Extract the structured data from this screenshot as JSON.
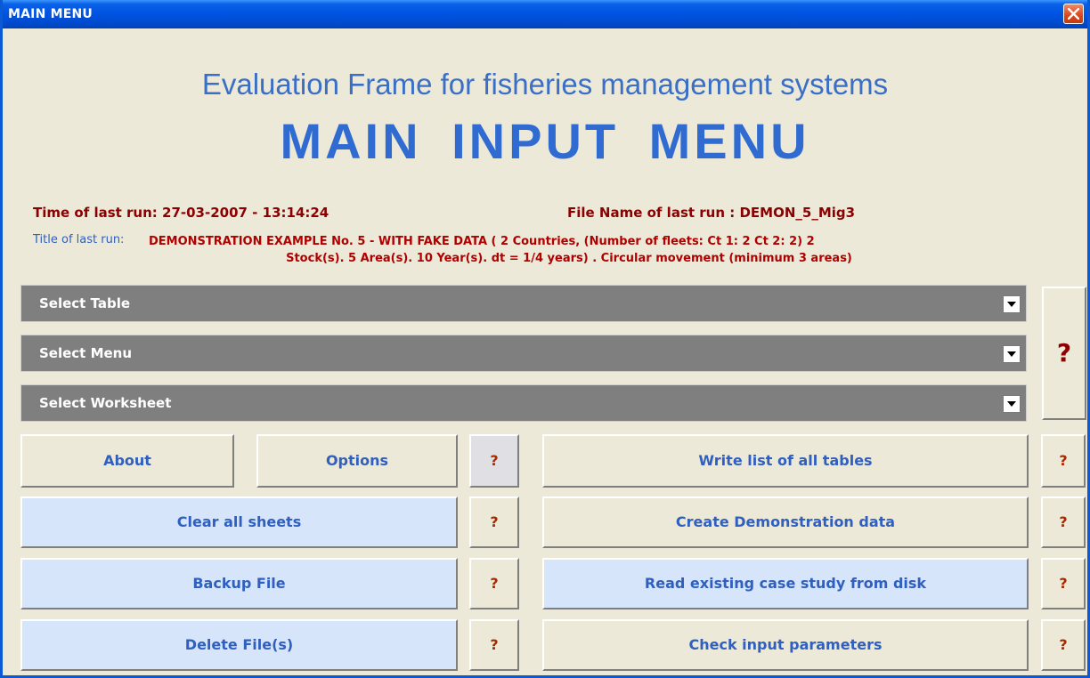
{
  "window": {
    "title": "MAIN MENU"
  },
  "header": {
    "subtitle": "Evaluation Frame for fisheries management systems",
    "title": "MAIN INPUT MENU"
  },
  "last_run": {
    "time_text": "Time of last run: 27-03-2007 - 13:14:24",
    "file_text": "File Name of last run : DEMON_5_Mig3",
    "title_label": "Title of last run:",
    "title_line1": "DEMONSTRATION EXAMPLE No. 5 -  WITH FAKE DATA (  2  Countries, (Number of fleets:  Ct 1:  2  Ct 2:  2)   2",
    "title_line2": "Stock(s).   5 Area(s).   10 Year(s).    dt = 1/4 years)  .  Circular movement (minimum 3 areas)"
  },
  "selectors": [
    {
      "label": "Select Table"
    },
    {
      "label": "Select Menu"
    },
    {
      "label": "Select Worksheet"
    }
  ],
  "help_glyph": "?",
  "buttons": {
    "about": "About",
    "options": "Options",
    "clear_all": "Clear all sheets",
    "backup": "Backup File",
    "delete": "Delete  File(s)",
    "write_list": "Write list of all tables",
    "create_demo": "Create Demonstration data",
    "read_case": "Read existing case study from disk",
    "check_params": "Check input parameters"
  }
}
